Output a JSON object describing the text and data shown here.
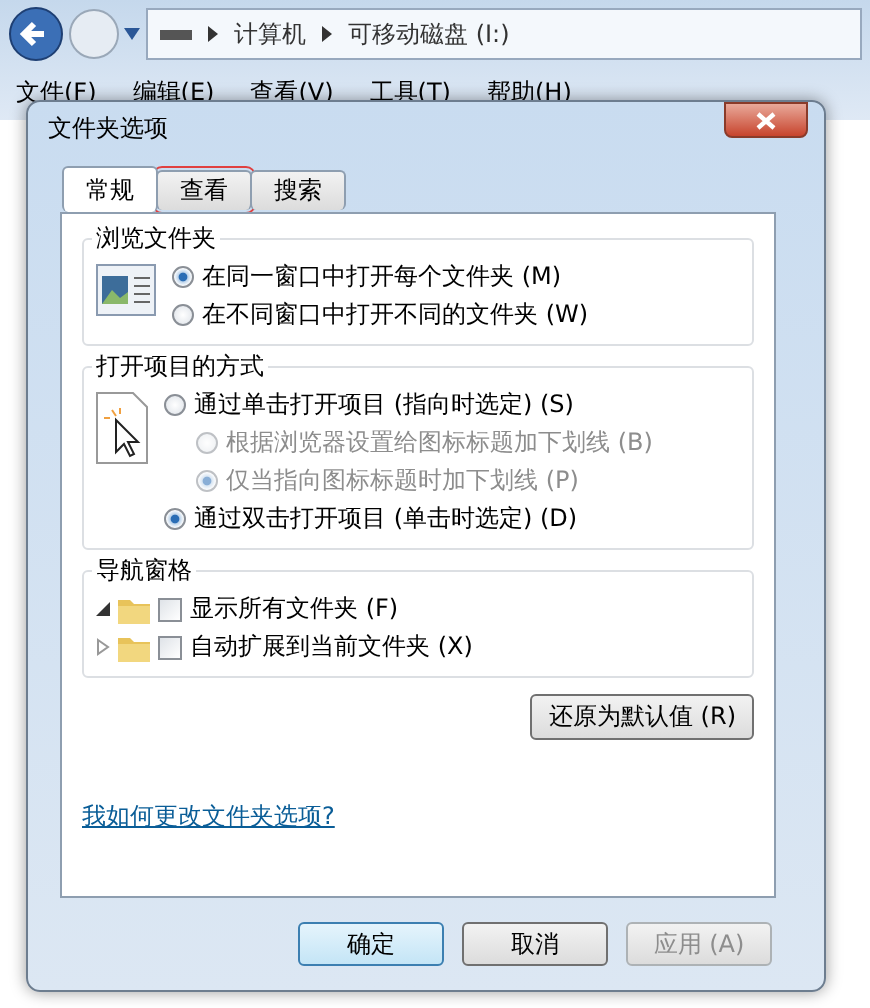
{
  "explorer": {
    "breadcrumb": [
      "计算机",
      "可移动磁盘 (I:)"
    ],
    "menu": [
      "文件(F)",
      "编辑(E)",
      "查看(V)",
      "工具(T)",
      "帮助(H)"
    ]
  },
  "dialog": {
    "title": "文件夹选项",
    "tabs": [
      {
        "label": "常规",
        "selected": true,
        "highlighted": false
      },
      {
        "label": "查看",
        "selected": false,
        "highlighted": true
      },
      {
        "label": "搜索",
        "selected": false,
        "highlighted": false
      }
    ],
    "groups": [
      {
        "title": "浏览文件夹",
        "kind": "window",
        "options": [
          {
            "kind": "radio",
            "label": "在同一窗口中打开每个文件夹 (M)",
            "selected": true,
            "disabled": false
          },
          {
            "kind": "radio",
            "label": "在不同窗口中打开不同的文件夹 (W)",
            "selected": false,
            "disabled": false
          }
        ]
      },
      {
        "title": "打开项目的方式",
        "kind": "click",
        "options": [
          {
            "kind": "radio",
            "label": "通过单击打开项目 (指向时选定) (S)",
            "selected": false,
            "disabled": false,
            "children": [
              {
                "kind": "radio",
                "label": "根据浏览器设置给图标标题加下划线 (B)",
                "selected": false,
                "disabled": true
              },
              {
                "kind": "radio",
                "label": "仅当指向图标标题时加下划线 (P)",
                "selected": true,
                "disabled": true
              }
            ]
          },
          {
            "kind": "radio",
            "label": "通过双击打开项目 (单击时选定) (D)",
            "selected": true,
            "disabled": false
          }
        ]
      },
      {
        "title": "导航窗格",
        "kind": "tree",
        "options": [
          {
            "kind": "checkbox",
            "label": "显示所有文件夹 (F)",
            "checked": false,
            "expanded": true
          },
          {
            "kind": "checkbox",
            "label": "自动扩展到当前文件夹 (X)",
            "checked": false,
            "expanded": false
          }
        ]
      }
    ],
    "restore_button": "还原为默认值 (R)",
    "help_link": "我如何更改文件夹选项?",
    "buttons": [
      {
        "label": "确定",
        "default": true,
        "disabled": false
      },
      {
        "label": "取消",
        "default": false,
        "disabled": false
      },
      {
        "label": "应用 (A)",
        "default": false,
        "disabled": true
      }
    ]
  }
}
